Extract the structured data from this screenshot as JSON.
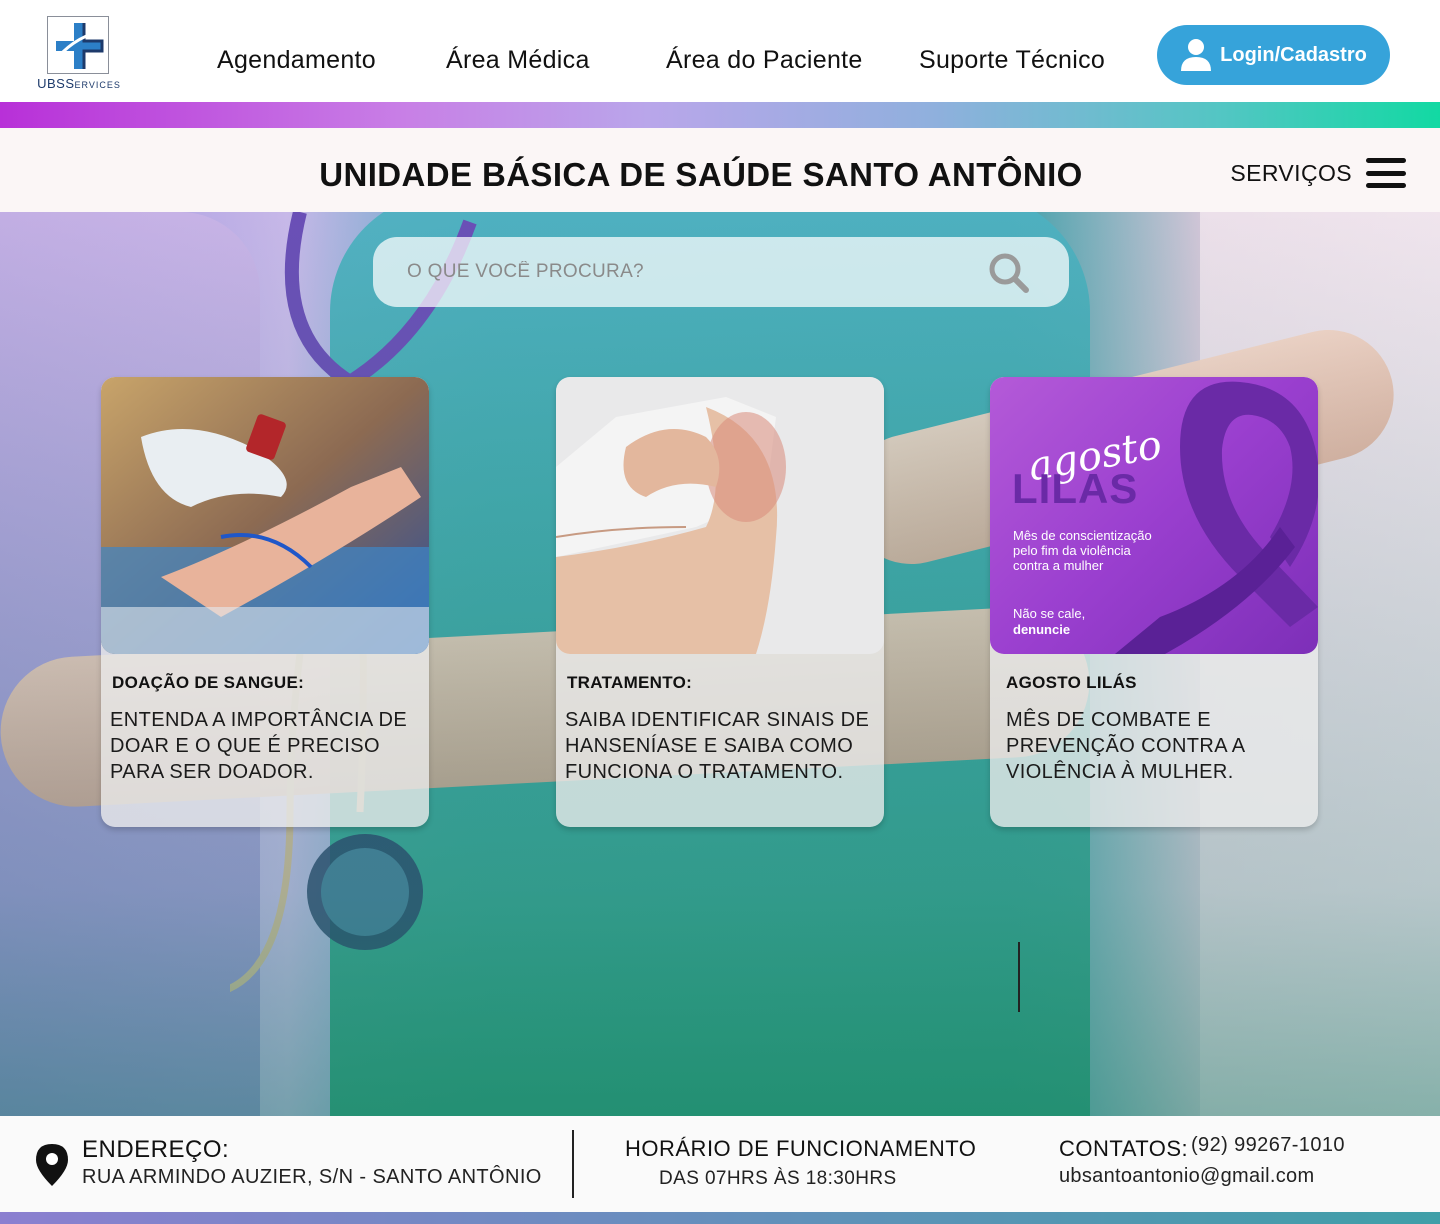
{
  "brand": {
    "logo_main": "UBS",
    "logo_sub": "ERVICES",
    "logo_initial": "S"
  },
  "nav": {
    "items": [
      {
        "label": "Agendamento"
      },
      {
        "label": "Área Médica"
      },
      {
        "label": "Área do Paciente"
      },
      {
        "label": "Suporte Técnico"
      }
    ],
    "login_label": "Login/Cadastro"
  },
  "header": {
    "title": "UNIDADE BÁSICA DE SAÚDE SANTO ANTÔNIO",
    "services_label": "SERVIÇOS"
  },
  "search": {
    "placeholder": "O QUE VOCÊ PROCURA?"
  },
  "cards": [
    {
      "tag": "DOAÇÃO DE SANGUE:",
      "description": "ENTENDA A IMPORTÂNCIA DE DOAR E O QUE É PRECISO PARA SER DOADOR."
    },
    {
      "tag": "TRATAMENTO:",
      "description": "SAIBA IDENTIFICAR SINAIS DE HANSENÍASE E SAIBA COMO FUNCIONA O TRATAMENTO."
    },
    {
      "tag": "AGOSTO LILÁS",
      "description": "MÊS DE COMBATE E PREVENÇÃO CONTRA A VIOLÊNCIA À MULHER.",
      "artwork": {
        "script_title": "agosto",
        "block_title": "LILAS",
        "subtitle_lines": [
          "Mês de conscientização",
          "pelo fim da violência",
          "contra a mulher"
        ],
        "cta_line1": "Não se cale,",
        "cta_line2": "denuncie"
      }
    }
  ],
  "footer": {
    "address_label": "ENDEREÇO:",
    "address_value": "RUA ARMINDO AUZIER, S/N - SANTO ANTÔNIO",
    "hours_label": "HORÁRIO DE FUNCIONAMENTO",
    "hours_value": "DAS 07HRS ÀS 18:30HRS",
    "contacts_label": "CONTATOS:",
    "phone": "(92) 99267-1010",
    "email": "ubsantoantonio@gmail.com"
  },
  "colors": {
    "login_button": "#36a3da",
    "gradient_start": "#b830d8",
    "gradient_end": "#12d9a3",
    "lilac": "#9a3fcf",
    "logo_blue": "#1d3a6b"
  }
}
